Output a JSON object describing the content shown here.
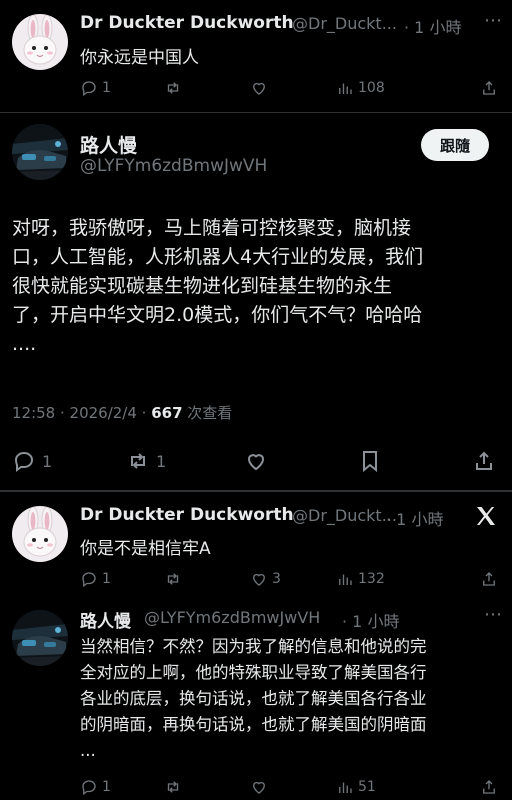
{
  "tweet1": {
    "name": "Dr Duckter Duckworth",
    "handle": "@Dr_Duckt...",
    "time": "· 1 小時",
    "text": "你永远是中国人",
    "replies": "1",
    "retweets": "",
    "likes": "",
    "views": "108"
  },
  "main": {
    "name": "路人慢",
    "handle": "@LYFYm6zdBmwJwVH",
    "follow_label": "跟隨",
    "text_lines": [
      "对呀，我骄傲呀，马上随着可控核聚变，脑机接",
      "口，人工智能，人形机器人4大行业的发展，我们",
      "很快就能实现碳基生物进化到硅基生物的永生",
      "了，开启中华文明2.0模式，你们气不气？哈哈哈",
      "...."
    ],
    "timestamp": "12:58 · 2026/2/4 · ",
    "views_count": "667",
    "views_label": " 次查看",
    "replies": "1",
    "retweets": "1"
  },
  "tweet3": {
    "name": "Dr Duckter Duckworth",
    "handle": "@Dr_Duckt...",
    "time": "· 1 小時",
    "text": "你是不是相信牢A",
    "replies": "1",
    "retweets": "",
    "likes": "3",
    "views": "132"
  },
  "tweet4": {
    "name": "路人慢",
    "handle": "@LYFYm6zdBmwJwVH",
    "time": "· 1 小時",
    "text_lines": [
      "当然相信？不然？因为我了解的信息和他说的完",
      "全对应的上啊，他的特殊职业导致了解美国各行",
      "各业的底层，换句话说，也就了解美国各行各业",
      "的阴暗面，再换句话说，也就了解美国的阴暗面",
      "..."
    ],
    "replies": "1",
    "retweets": "",
    "likes": "",
    "views": "51"
  },
  "icons": {
    "reply": "reply-icon",
    "retweet": "retweet-icon",
    "like": "heart-icon",
    "views": "views-icon",
    "share": "share-icon",
    "bookmark": "bookmark-icon",
    "more": "more-icon",
    "x_logo": "x-logo-icon"
  },
  "colors": {
    "background": "#000000",
    "text": "#e7e9ea",
    "secondary": "#71767b",
    "divider": "#2f3336"
  }
}
